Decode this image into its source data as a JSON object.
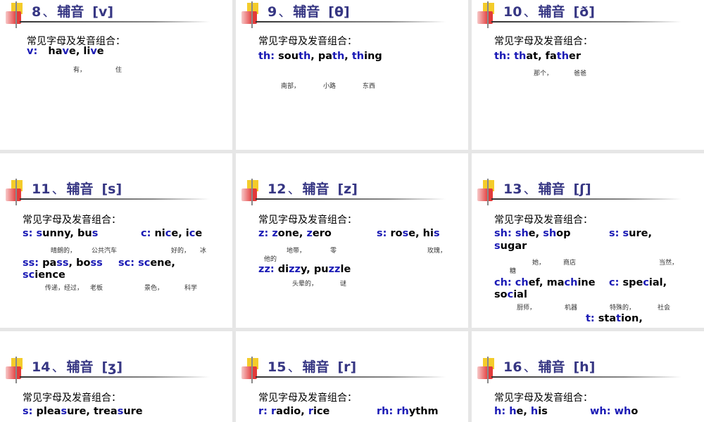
{
  "subtitle": "常见字母及发音组合：",
  "slides": [
    {
      "num": "8",
      "sep": "、",
      "word": "辅音",
      "phoneme": "[v]",
      "lines": [
        {
          "parts": [
            {
              "t": "v:",
              "k": 1
            },
            {
              "t": "   ha"
            },
            {
              "t": "v",
              "k": 1
            },
            {
              "t": "e, li"
            },
            {
              "t": "v",
              "k": 1
            },
            {
              "t": "e"
            }
          ]
        }
      ],
      "cn": [
        "有，",
        "住"
      ]
    },
    {
      "num": "9",
      "sep": "、",
      "word": "辅音",
      "phoneme": "[θ]",
      "lines": [
        {
          "parts": [
            {
              "t": "th:",
              "k": 1
            },
            {
              "t": " sou"
            },
            {
              "t": "th",
              "k": 1
            },
            {
              "t": ", pa"
            },
            {
              "t": "th",
              "k": 1
            },
            {
              "t": ", "
            },
            {
              "t": "th",
              "k": 1
            },
            {
              "t": "ing"
            }
          ]
        }
      ],
      "cn": [
        "南部，",
        "小路",
        "东西"
      ]
    },
    {
      "num": "10",
      "sep": "、",
      "word": "辅音",
      "phoneme": "[ð]",
      "lines": [
        {
          "parts": [
            {
              "t": "th:",
              "k": 1
            },
            {
              "t": " "
            },
            {
              "t": "th",
              "k": 1
            },
            {
              "t": "at, fa"
            },
            {
              "t": "th",
              "k": 1
            },
            {
              "t": "er"
            }
          ]
        }
      ],
      "cn": [
        "那个，",
        "爸爸"
      ]
    },
    {
      "num": "11",
      "sep": "、",
      "word": "辅音",
      "phoneme": "[s]",
      "lines": [
        {
          "parts": [
            {
              "t": "s:",
              "k": 1
            },
            {
              "t": " "
            },
            {
              "t": "s",
              "k": 1
            },
            {
              "t": "unny, bu"
            },
            {
              "t": "s",
              "k": 1
            }
          ]
        },
        {
          "parts": [
            {
              "t": "c:",
              "k": 1
            },
            {
              "t": " ni"
            },
            {
              "t": "c",
              "k": 1
            },
            {
              "t": "e, i"
            },
            {
              "t": "c",
              "k": 1
            },
            {
              "t": "e"
            }
          ]
        },
        {
          "parts": [
            {
              "t": "ss:",
              "k": 1
            },
            {
              "t": " pa"
            },
            {
              "t": "ss",
              "k": 1
            },
            {
              "t": ", bo"
            },
            {
              "t": "ss",
              "k": 1
            }
          ]
        },
        {
          "parts": [
            {
              "t": "sc:",
              "k": 1
            },
            {
              "t": " "
            },
            {
              "t": "sc",
              "k": 1
            },
            {
              "t": "ene,"
            }
          ]
        },
        {
          "parts": [
            {
              "t": "sc",
              "k": 1
            },
            {
              "t": "ience"
            }
          ]
        }
      ],
      "cn": [
        "晴朗的，",
        "公共汽车",
        "好的，",
        "冰",
        "传递，经过，",
        "老板",
        "景色，",
        "科学"
      ]
    },
    {
      "num": "12",
      "sep": "、",
      "word": "辅音",
      "phoneme": "[z]",
      "lines": [
        {
          "parts": [
            {
              "t": "z:",
              "k": 1
            },
            {
              "t": " "
            },
            {
              "t": "z",
              "k": 1
            },
            {
              "t": "one, "
            },
            {
              "t": "z",
              "k": 1
            },
            {
              "t": "ero"
            }
          ]
        },
        {
          "parts": [
            {
              "t": "s:",
              "k": 1
            },
            {
              "t": " ro"
            },
            {
              "t": "s",
              "k": 1
            },
            {
              "t": "e, hi"
            },
            {
              "t": "s",
              "k": 1
            }
          ]
        },
        {
          "parts": [
            {
              "t": "zz:",
              "k": 1
            },
            {
              "t": " di"
            },
            {
              "t": "zz",
              "k": 1
            },
            {
              "t": "y, pu"
            },
            {
              "t": "zz",
              "k": 1
            },
            {
              "t": "le"
            }
          ]
        }
      ],
      "cn": [
        "地带，",
        "零",
        "玫瑰，",
        "他的",
        "头晕的，",
        "谜"
      ]
    },
    {
      "num": "13",
      "sep": "、",
      "word": "辅音",
      "phoneme": "[ʃ]",
      "lines": [
        {
          "parts": [
            {
              "t": "sh:",
              "k": 1
            },
            {
              "t": " "
            },
            {
              "t": "sh",
              "k": 1
            },
            {
              "t": "e, "
            },
            {
              "t": "sh",
              "k": 1
            },
            {
              "t": "op"
            }
          ]
        },
        {
          "parts": [
            {
              "t": "s:",
              "k": 1
            },
            {
              "t": " "
            },
            {
              "t": "s",
              "k": 1
            },
            {
              "t": "ure,"
            }
          ]
        },
        {
          "parts": [
            {
              "t": "s",
              "k": 1
            },
            {
              "t": "ugar"
            }
          ]
        },
        {
          "parts": [
            {
              "t": "ch:",
              "k": 1
            },
            {
              "t": " "
            },
            {
              "t": "ch",
              "k": 1
            },
            {
              "t": "ef, ma"
            },
            {
              "t": "ch",
              "k": 1
            },
            {
              "t": "ine"
            }
          ]
        },
        {
          "parts": [
            {
              "t": "c:",
              "k": 1
            },
            {
              "t": " spe"
            },
            {
              "t": "c",
              "k": 1
            },
            {
              "t": "ial,"
            }
          ]
        },
        {
          "parts": [
            {
              "t": "so"
            },
            {
              "t": "c",
              "k": 1
            },
            {
              "t": "ial"
            }
          ]
        },
        {
          "parts": [
            {
              "t": "t:",
              "k": 1
            },
            {
              "t": " sta"
            },
            {
              "t": "t",
              "k": 1
            },
            {
              "t": "ion,"
            }
          ]
        }
      ],
      "cn": [
        "她，",
        "商店",
        "当然，",
        "糖",
        "厨师，",
        "机器",
        "特殊的，",
        "社会"
      ]
    },
    {
      "num": "14",
      "sep": "、",
      "word": "辅音",
      "phoneme": "[ʒ]",
      "lines": [
        {
          "parts": [
            {
              "t": "s:",
              "k": 1
            },
            {
              "t": " plea"
            },
            {
              "t": "s",
              "k": 1
            },
            {
              "t": "ure, trea"
            },
            {
              "t": "s",
              "k": 1
            },
            {
              "t": "ure"
            }
          ]
        }
      ],
      "cn": []
    },
    {
      "num": "15",
      "sep": "、",
      "word": "辅音",
      "phoneme": "[r]",
      "lines": [
        {
          "parts": [
            {
              "t": "r:",
              "k": 1
            },
            {
              "t": " "
            },
            {
              "t": "r",
              "k": 1
            },
            {
              "t": "adio, "
            },
            {
              "t": "r",
              "k": 1
            },
            {
              "t": "ice"
            }
          ]
        },
        {
          "parts": [
            {
              "t": "rh:",
              "k": 1
            },
            {
              "t": " "
            },
            {
              "t": "rh",
              "k": 1
            },
            {
              "t": "ythm"
            }
          ]
        }
      ],
      "cn": []
    },
    {
      "num": "16",
      "sep": "、",
      "word": "辅音",
      "phoneme": "[h]",
      "lines": [
        {
          "parts": [
            {
              "t": "h:",
              "k": 1
            },
            {
              "t": " "
            },
            {
              "t": "h",
              "k": 1
            },
            {
              "t": "e, "
            },
            {
              "t": "h",
              "k": 1
            },
            {
              "t": "is"
            }
          ]
        },
        {
          "parts": [
            {
              "t": "wh:",
              "k": 1
            },
            {
              "t": " "
            },
            {
              "t": "wh",
              "k": 1
            },
            {
              "t": "o"
            }
          ]
        }
      ],
      "cn": []
    }
  ]
}
